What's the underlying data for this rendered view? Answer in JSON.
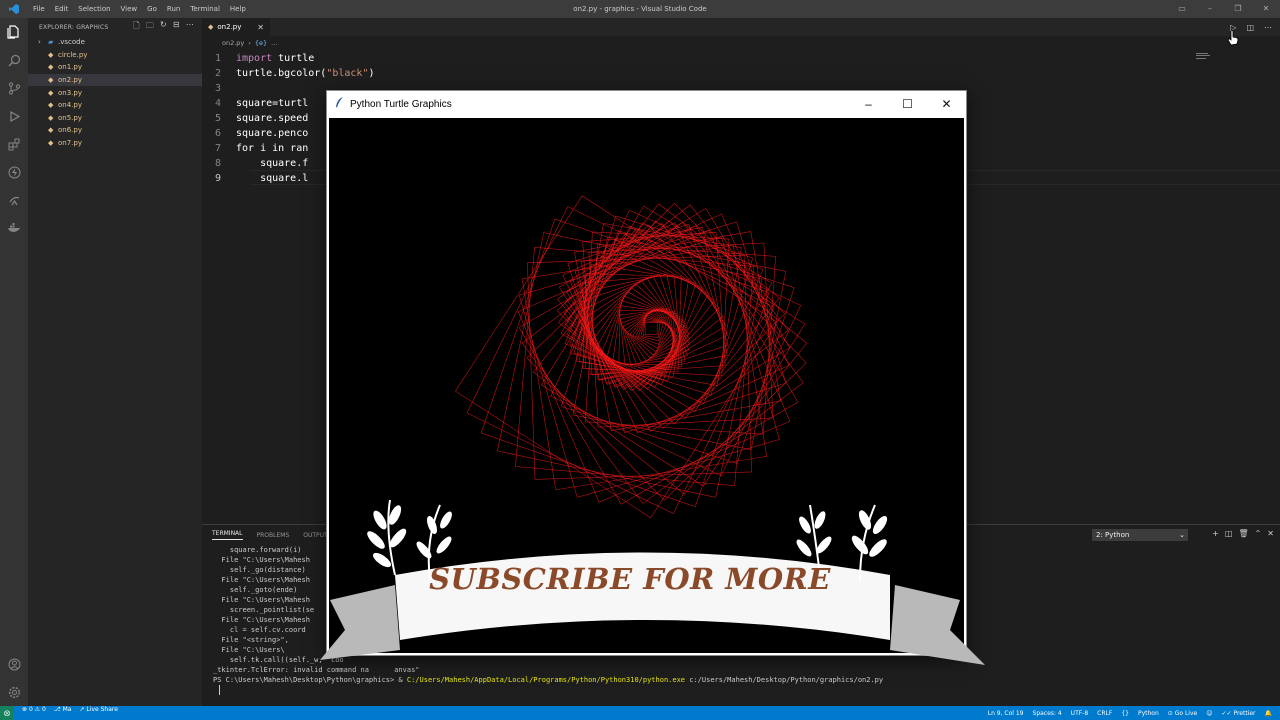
{
  "window": {
    "title": "on2.py - graphics - Visual Studio Code",
    "menu": [
      "File",
      "Edit",
      "Selection",
      "View",
      "Go",
      "Run",
      "Terminal",
      "Help"
    ]
  },
  "sidebar": {
    "header": "EXPLORER: GRAPHICS",
    "folder": ".vscode",
    "files": [
      "circle.py",
      "on1.py",
      "on2.py",
      "on3.py",
      "on4.py",
      "on5.py",
      "on6.py",
      "on7.py"
    ],
    "selected": "on2.py"
  },
  "editor": {
    "tab": "on2.py",
    "breadcrumb": [
      "on2.py",
      "{e}",
      "..."
    ],
    "lines": [
      {
        "n": "1",
        "a": "import",
        "b": " turtle"
      },
      {
        "n": "2",
        "a": "turtle.bgcolor(",
        "b": "\"black\"",
        "c": ")"
      },
      {
        "n": "3",
        "a": "",
        "b": ""
      },
      {
        "n": "4",
        "a": "square=turtl",
        "b": ""
      },
      {
        "n": "5",
        "a": "square.speed",
        "b": ""
      },
      {
        "n": "6",
        "a": "square.penco",
        "b": ""
      },
      {
        "n": "7",
        "a": "for i in ran",
        "b": ""
      },
      {
        "n": "8",
        "a": "    square.f",
        "b": ""
      },
      {
        "n": "9",
        "a": "    square.l",
        "b": ""
      }
    ]
  },
  "panel": {
    "tabs": [
      "TERMINAL",
      "PROBLEMS",
      "OUTPUT"
    ],
    "select": "2: Python",
    "terminal": [
      "    square.forward(i)",
      "  File \"C:\\Users\\Mahesh",
      "    self._go(distance)",
      "  File \"C:\\Users\\Mahesh",
      "    self._goto(ende)",
      "  File \"C:\\Users\\Mahesh",
      "    screen._pointlist(se",
      "  File \"C:\\Users\\Mahesh",
      "    cl = self.cv.coord",
      "  File \"<string>\",",
      "  File \"C:\\Users\\",
      "    self.tk.call((self._w, 'coo",
      "_tkinter.TclError: invalid command na      anvas\""
    ],
    "prompt": "PS C:\\Users\\Mahesh\\Desktop\\Python\\graphics> & ",
    "exe": "C:/Users/Mahesh/AppData/Local/Programs/Python/Python310/python.exe",
    "arg": " c:/Users/Mahesh/Desktop/Python/graphics/on2.py"
  },
  "status": {
    "errors": "0",
    "warnings": "0",
    "branch": "Ma",
    "live_share": "Live Share",
    "position": "Ln 9, Col 19",
    "spaces": "Spaces: 4",
    "encoding": "UTF-8",
    "eol": "CRLF",
    "language": "Python",
    "go_live": "Go Live",
    "prettier": "Prettier"
  },
  "turtle_window": {
    "title": "Python Turtle Graphics",
    "bg_color": "#000000",
    "pen_color": "#ff1a1a"
  },
  "overlay": {
    "text": "SUBSCRIBE FOR MORE"
  }
}
